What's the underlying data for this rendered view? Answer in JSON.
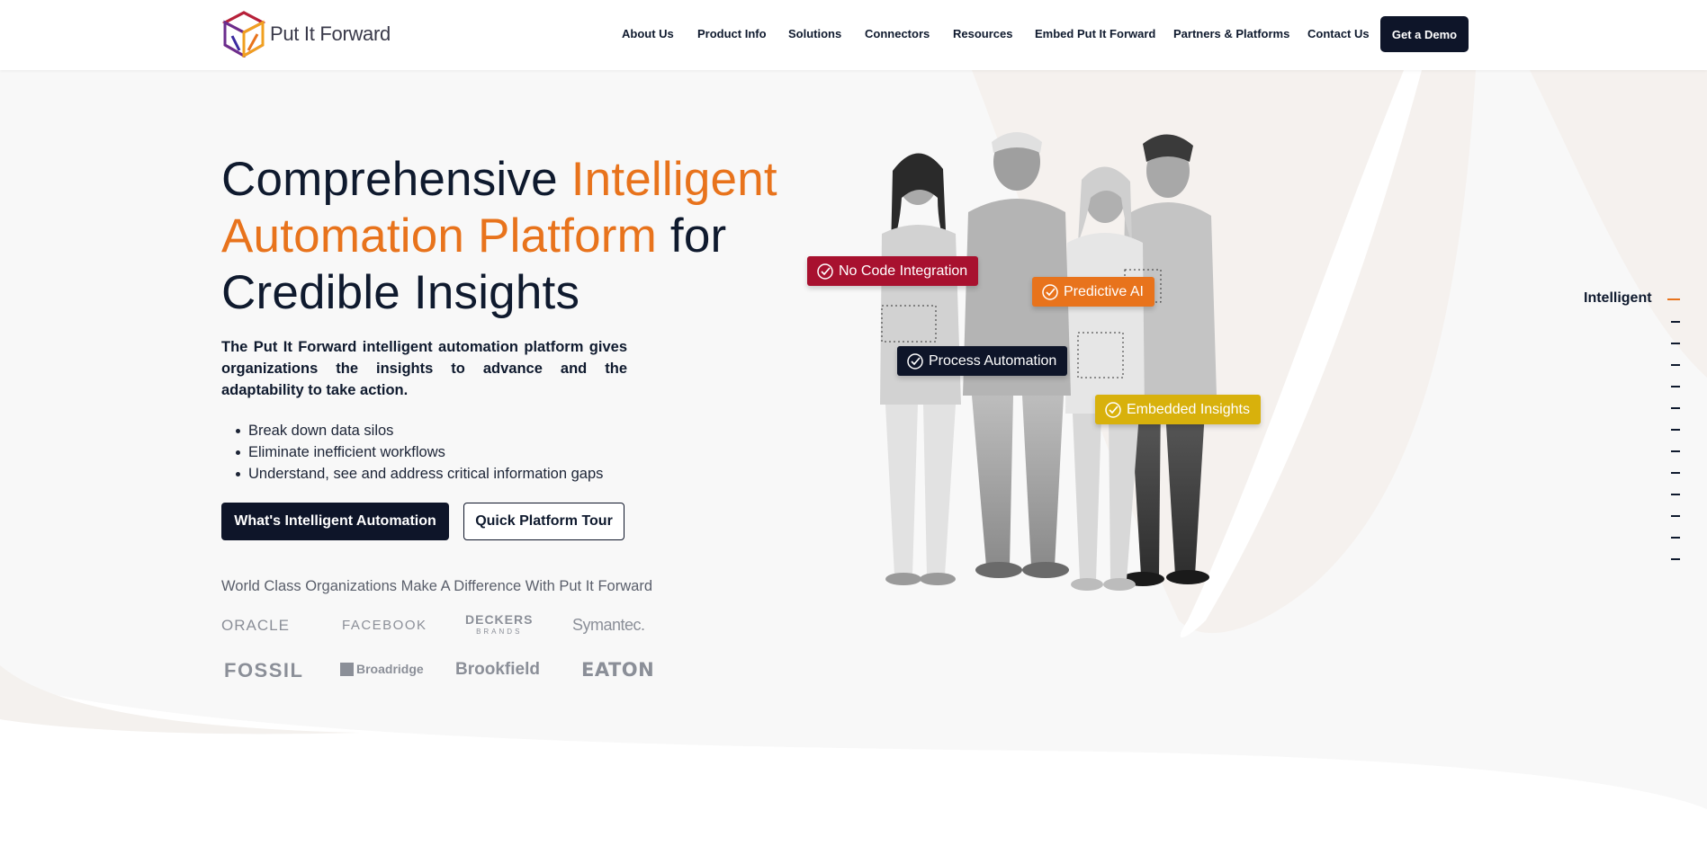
{
  "header": {
    "logo_text": "Put It Forward",
    "nav": [
      {
        "label": "About Us"
      },
      {
        "label": "Product Info"
      },
      {
        "label": "Solutions"
      },
      {
        "label": "Connectors"
      },
      {
        "label": "Resources"
      },
      {
        "label": "Embed Put It Forward"
      },
      {
        "label": "Partners & Platforms"
      },
      {
        "label": "Contact Us"
      }
    ],
    "cta_label": "Get a Demo"
  },
  "hero": {
    "title_part1": "Comprehensive ",
    "title_accent": "Intelligent Automation Platform",
    "title_part2": " for Credible Insights",
    "description": "The Put It Forward intelligent automation platform gives organizations the insights to advance and the adaptability to take action.",
    "bullets": [
      "Break down data silos",
      "Eliminate inefficient workflows",
      "Understand, see and address critical information gaps"
    ],
    "primary_button": "What's Intelligent Automation",
    "secondary_button": "Quick Platform Tour"
  },
  "organizations": {
    "title": "World Class Organizations Make A Difference With Put It Forward",
    "logos": [
      "ORACLE",
      "FACEBOOK",
      "DECKERS",
      "BRANDS",
      "Symantec.",
      "FOSSIL",
      "Broadridge",
      "Brookfield",
      "EATON"
    ]
  },
  "tags": [
    {
      "label": "No Code Integration",
      "color": "#a8112f"
    },
    {
      "label": "Predictive AI",
      "color": "#e8731c"
    },
    {
      "label": "Process Automation",
      "color": "#0e1529"
    },
    {
      "label": "Embedded Insights",
      "color": "#d8b10c"
    }
  ],
  "side_nav": {
    "active_label": "Intelligent"
  },
  "colors": {
    "accent": "#e8731c",
    "navy": "#0e1529"
  }
}
